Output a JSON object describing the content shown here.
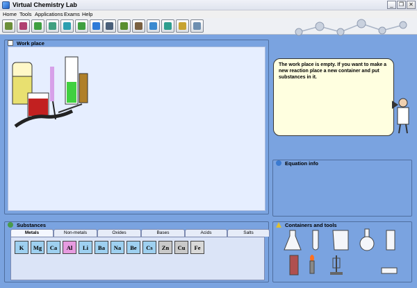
{
  "window": {
    "title": "Virtual Chemistry Lab",
    "controls": [
      "_",
      "❐",
      "✕"
    ]
  },
  "menu": [
    "Home",
    "Tools",
    "Applications",
    "Exams",
    "Help"
  ],
  "toolbar": {
    "icon_colors": [
      "#6b8f3a",
      "#b04070",
      "#3f9f40",
      "#40a080",
      "#2c9fb0",
      "#3f9f40",
      "#2d7ad8",
      "#4a5f7a",
      "#5a8f2f",
      "#7a6040",
      "#3a8ad0",
      "#2e9e8e",
      "#c7a330",
      "#6e8fb0"
    ]
  },
  "workplace": {
    "title": "Work place"
  },
  "assistant": {
    "message": "The work place is empty. If you want to make a new reaction  place a new container and put substances in it."
  },
  "equation": {
    "title": "Equation info"
  },
  "substances": {
    "title": "Substances",
    "tabs": [
      "Metals",
      "Non-metals",
      "Oxides",
      "Bases",
      "Acids",
      "Salts"
    ],
    "elements": [
      {
        "symbol": "K",
        "color": "#9ed0f0"
      },
      {
        "symbol": "Mg",
        "color": "#9ed0f0"
      },
      {
        "symbol": "Ca",
        "color": "#9ed0f0"
      },
      {
        "symbol": "Al",
        "color": "#e79be0"
      },
      {
        "symbol": "Li",
        "color": "#9ed0f0"
      },
      {
        "symbol": "Ba",
        "color": "#9ed0f0"
      },
      {
        "symbol": "Na",
        "color": "#9ed0f0"
      },
      {
        "symbol": "Be",
        "color": "#9ed0f0"
      },
      {
        "symbol": "Cs",
        "color": "#9ed0f0"
      },
      {
        "symbol": "Zn",
        "color": "#c9c9c9"
      },
      {
        "symbol": "Cu",
        "color": "#c9c9c9"
      },
      {
        "symbol": "Fe",
        "color": "#d9d9d9"
      }
    ]
  },
  "containers": {
    "title": "Containers and tools"
  }
}
